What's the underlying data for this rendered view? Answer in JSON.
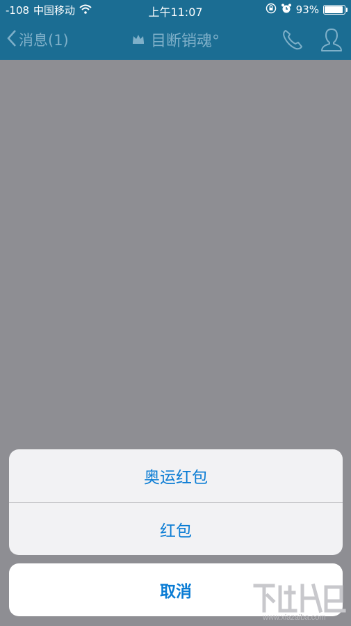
{
  "status_bar": {
    "signal": "-108",
    "carrier": "中国移动",
    "time": "上午11:07",
    "battery_percent": "93%",
    "battery_level": 0.93,
    "icons": [
      "wifi-icon",
      "orientation-lock-icon",
      "alarm-icon",
      "battery-icon"
    ]
  },
  "nav": {
    "back_label": "消息(1)",
    "title": "目断销魂°",
    "icons": [
      "chevron-left-icon",
      "crown-icon",
      "phone-icon",
      "profile-icon"
    ]
  },
  "action_sheet": {
    "options": [
      "奥运红包",
      "红包"
    ],
    "cancel_label": "取消"
  },
  "colors": {
    "navbar": "#1b6d93",
    "nav_text": "#7fb0c9",
    "overlay": "#8e8e93",
    "action_text": "#0a7cd4"
  }
}
